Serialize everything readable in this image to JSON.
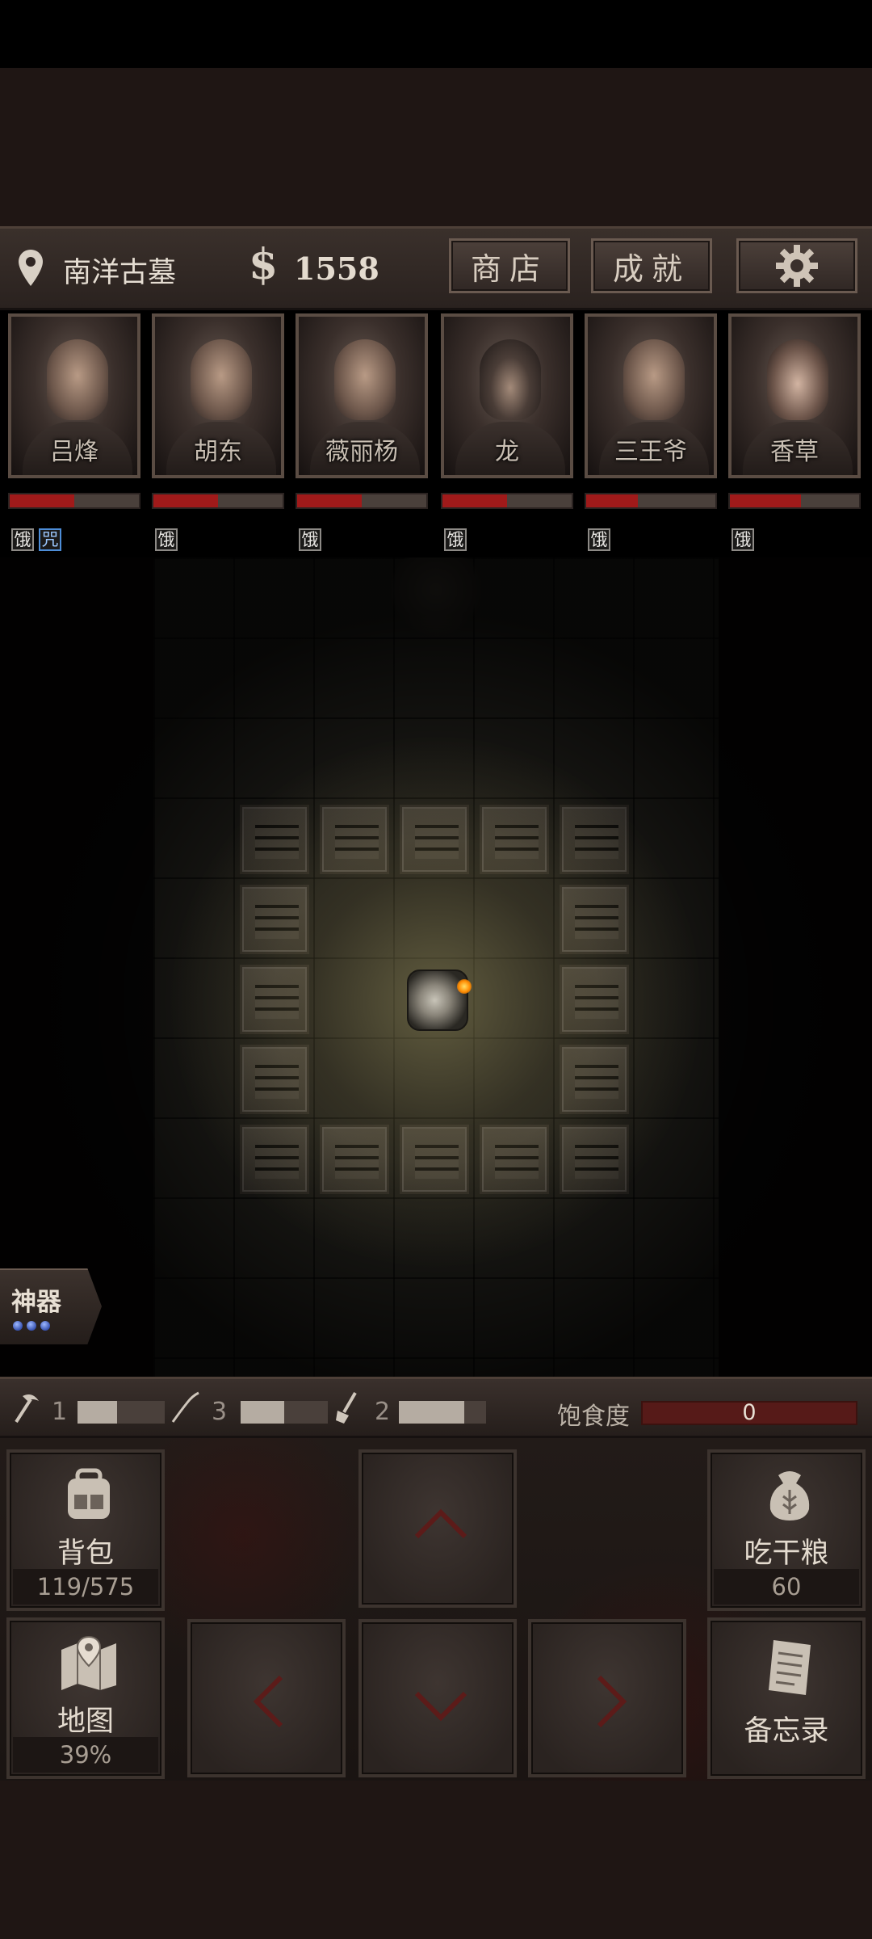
{
  "header": {
    "location": "南洋古墓",
    "currency_symbol": "$",
    "gold": "1558",
    "shop_label": "商店",
    "achievements_label": "成就"
  },
  "characters": [
    {
      "name": "吕烽",
      "hp": 0.5,
      "status": [
        "饿",
        "咒"
      ]
    },
    {
      "name": "胡东",
      "hp": 0.5,
      "status": [
        "饿"
      ]
    },
    {
      "name": "薇丽杨",
      "hp": 0.5,
      "status": [
        "饿"
      ]
    },
    {
      "name": "龙",
      "hp": 0.5,
      "status": [
        "饿"
      ]
    },
    {
      "name": "三王爷",
      "hp": 0.4,
      "status": [
        "饿"
      ]
    },
    {
      "name": "香草",
      "hp": 0.55,
      "status": [
        "饿"
      ]
    }
  ],
  "artifact": {
    "label": "神器",
    "charges": 3
  },
  "tools": [
    {
      "icon": "pickaxe-icon",
      "count": "1",
      "level": 0.45
    },
    {
      "icon": "rope-icon",
      "count": "3",
      "level": 0.5
    },
    {
      "icon": "shovel-icon",
      "count": "2",
      "level": 0.75
    }
  ],
  "satiety": {
    "label": "饱食度",
    "value": "0",
    "level": 0
  },
  "backpack": {
    "label": "背包",
    "value": "119/575"
  },
  "eat": {
    "label": "吃干粮",
    "value": "60"
  },
  "map": {
    "label": "地图",
    "value": "39%"
  },
  "memo": {
    "label": "备忘录"
  },
  "colors": {
    "accent_red": "#a01a1a",
    "cursed_blue": "#4d8dd8",
    "panel_brown": "#3a302c"
  }
}
